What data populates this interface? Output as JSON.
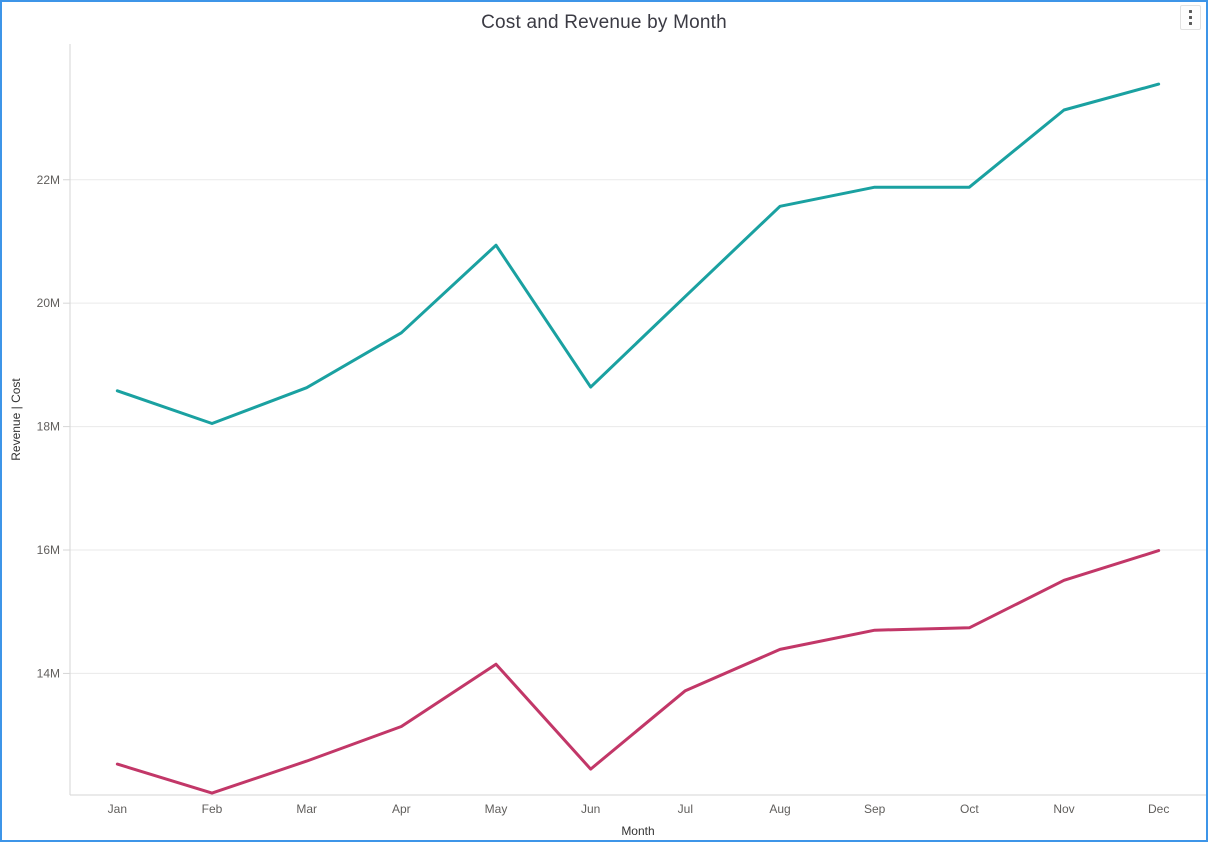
{
  "header": {
    "title": "Cost and Revenue by Month",
    "more_options_icon": "kebab-vertical"
  },
  "colors": {
    "card_border": "#3D95E8",
    "grid_line": "#EAEAEA",
    "axis_line": "#D6D6D6",
    "tick_label": "#605E5C",
    "axis_title": "#333333",
    "title_text": "#3B3B44",
    "revenue_line": "#1AA1A1",
    "cost_line": "#C23768"
  },
  "chart_data": {
    "type": "line",
    "title": "Cost and Revenue by Month",
    "xlabel": "Month",
    "ylabel": "Revenue  |  Cost",
    "legend": "none",
    "grid": true,
    "categories": [
      "Jan",
      "Feb",
      "Mar",
      "Apr",
      "May",
      "Jun",
      "Jul",
      "Aug",
      "Sep",
      "Oct",
      "Nov",
      "Dec"
    ],
    "series": [
      {
        "name": "Revenue",
        "color": "#1AA1A1",
        "values_millions": [
          18.58,
          18.05,
          18.63,
          19.52,
          20.94,
          18.64,
          20.11,
          21.57,
          21.88,
          21.88,
          23.13,
          23.55
        ]
      },
      {
        "name": "Cost",
        "color": "#C23768",
        "values_millions": [
          12.53,
          12.06,
          12.58,
          13.14,
          14.15,
          12.45,
          13.72,
          14.39,
          14.7,
          14.74,
          15.51,
          15.99
        ]
      }
    ],
    "y_ticks": [
      {
        "value": 14,
        "label": "14M"
      },
      {
        "value": 16,
        "label": "16M"
      },
      {
        "value": 18,
        "label": "18M"
      },
      {
        "value": 20,
        "label": "20M"
      },
      {
        "value": 22,
        "label": "22M"
      }
    ],
    "y_domain_millions": [
      12.03,
      24.2
    ]
  }
}
